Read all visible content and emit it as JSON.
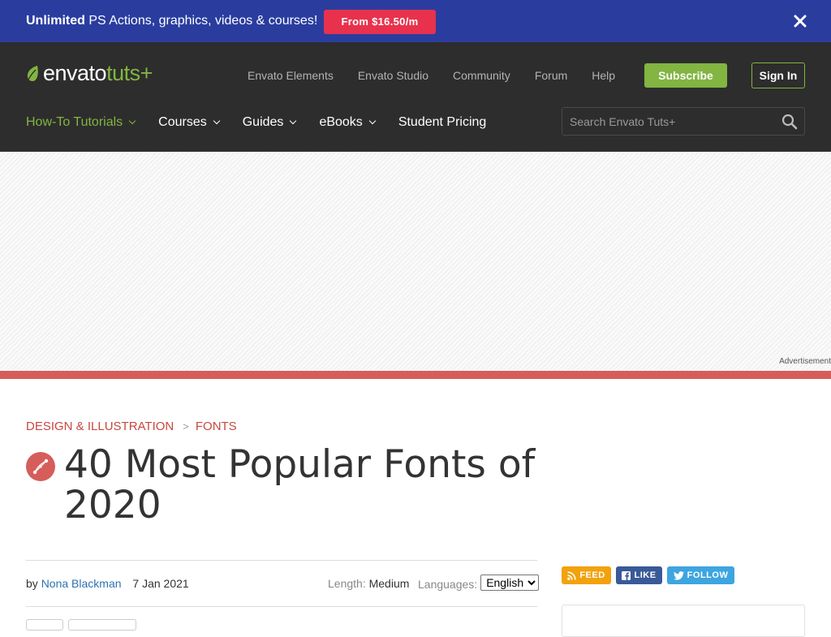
{
  "promo": {
    "bold": "Unlimited",
    "text": "PS Actions, graphics, videos & courses!",
    "cta": "From $16.50/m"
  },
  "logo": {
    "word1": "envato",
    "word2": "tuts+"
  },
  "topnav": [
    "Envato Elements",
    "Envato Studio",
    "Community",
    "Forum",
    "Help"
  ],
  "buttons": {
    "subscribe": "Subscribe",
    "signin": "Sign In"
  },
  "mainnav": [
    {
      "label": "How-To Tutorials",
      "dropdown": true,
      "active": true
    },
    {
      "label": "Courses",
      "dropdown": true
    },
    {
      "label": "Guides",
      "dropdown": true
    },
    {
      "label": "eBooks",
      "dropdown": true
    },
    {
      "label": "Student Pricing",
      "dropdown": false
    }
  ],
  "search": {
    "placeholder": "Search Envato Tuts+"
  },
  "ad": {
    "label": "Advertisement"
  },
  "breadcrumb": {
    "category": "DESIGN & ILLUSTRATION",
    "separator": ">",
    "subcategory": "FONTS"
  },
  "article": {
    "title": "40 Most Popular Fonts of 2020",
    "by": "by",
    "author": "Nona Blackman",
    "date": "7 Jan 2021",
    "length_label": "Length:",
    "length_value": "Medium",
    "languages_label": "Languages:",
    "language_selected": "English"
  },
  "social": {
    "feed": "FEED",
    "like": "LIKE",
    "follow": "FOLLOW"
  },
  "colors": {
    "promo_bg": "#2a3d9f",
    "cta": "#e8324d",
    "header_bg": "#2d2d2d",
    "brand_green": "#82b541",
    "accent_red": "#d55e5b"
  }
}
